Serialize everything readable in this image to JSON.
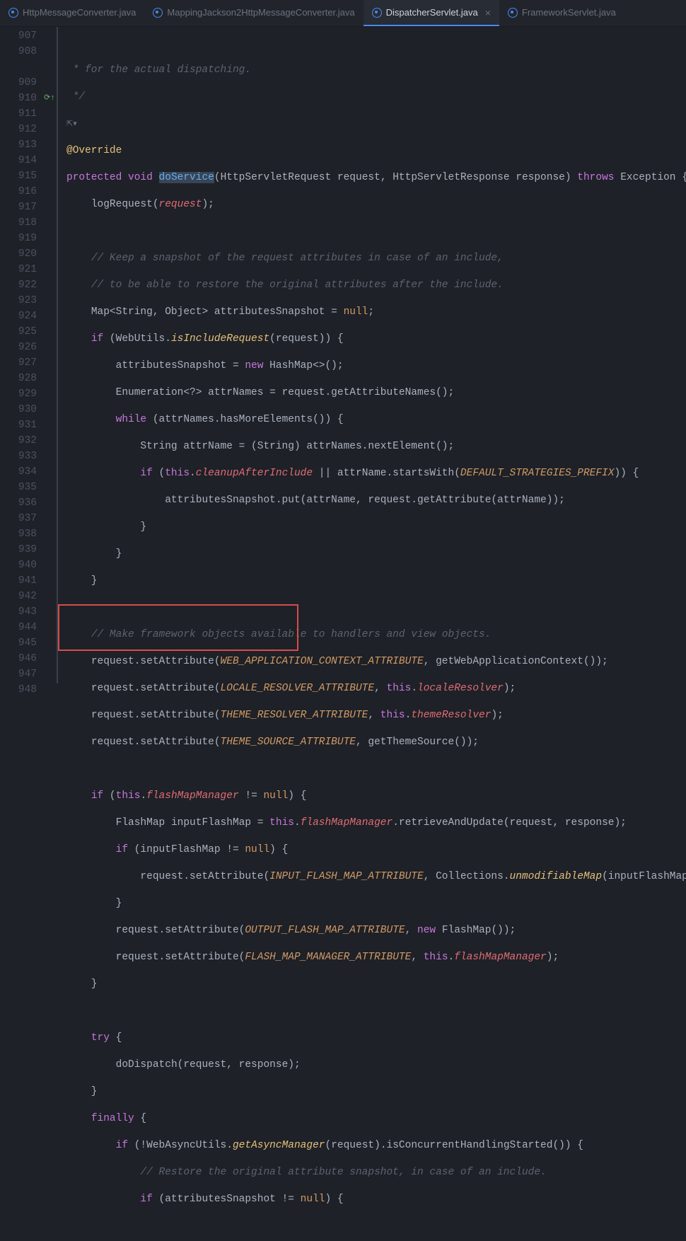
{
  "tabs": [
    {
      "label": "HttpMessageConverter.java",
      "active": false,
      "close": false
    },
    {
      "label": "MappingJackson2HttpMessageConverter.java",
      "active": false,
      "close": false
    },
    {
      "label": "DispatcherServlet.java",
      "active": true,
      "close": true
    },
    {
      "label": "FrameworkServlet.java",
      "active": false,
      "close": false
    }
  ],
  "gutter_start": 907,
  "line_numbers": [
    "907",
    "908",
    "",
    "909",
    "910",
    "911",
    "912",
    "913",
    "914",
    "915",
    "916",
    "917",
    "918",
    "919",
    "920",
    "921",
    "922",
    "923",
    "924",
    "925",
    "926",
    "927",
    "928",
    "929",
    "930",
    "931",
    "932",
    "933",
    "934",
    "935",
    "936",
    "937",
    "938",
    "939",
    "940",
    "941",
    "942",
    "943",
    "944",
    "945",
    "946",
    "947",
    "948"
  ],
  "marker_line_index": 4,
  "code": {
    "l907": " * for the actual dispatching.",
    "l908": " */",
    "author_hint": "⇱▾",
    "l909": "@Override",
    "l910": {
      "kw_protected": "protected",
      "kw_void": "void",
      "method": "doService",
      "sig_open": "(HttpServletRequest request, HttpServletResponse response)",
      "throws": "throws",
      "exc": "Exception {"
    },
    "l911": {
      "call": "logRequest",
      "open": "(",
      "arg": "request",
      "close": ");"
    },
    "l913": "// Keep a snapshot of the request attributes in case of an include,",
    "l914": "// to be able to restore the original attributes after the include.",
    "l915": {
      "a": "Map<String, Object> attributesSnapshot = ",
      "null": "null",
      "semi": ";"
    },
    "l916": {
      "if": "if",
      "open": " (WebUtils.",
      "fn": "isIncludeRequest",
      "after": "(request)) {"
    },
    "l917": {
      "a": "attributesSnapshot = ",
      "new": "new",
      "after": " HashMap<>();"
    },
    "l918": "Enumeration<?> attrNames = request.getAttributeNames();",
    "l919": {
      "while": "while",
      "after": " (attrNames.hasMoreElements()) {"
    },
    "l920": "String attrName = (String) attrNames.nextElement();",
    "l921": {
      "if": "if",
      "open": " (",
      "this": "this",
      "dot": ".",
      "field": "cleanupAfterInclude",
      "mid": " || attrName.startsWith(",
      "const": "DEFAULT_STRATEGIES_PREFIX",
      "close": ")) {"
    },
    "l922": "attributesSnapshot.put(attrName, request.getAttribute(attrName));",
    "l927": "// Make framework objects available to handlers and view objects.",
    "l928": {
      "pre": "request.setAttribute(",
      "const": "WEB_APPLICATION_CONTEXT_ATTRIBUTE",
      "post": ", getWebApplicationContext());"
    },
    "l929": {
      "pre": "request.setAttribute(",
      "const": "LOCALE_RESOLVER_ATTRIBUTE",
      "post": ", ",
      "this": "this",
      "dot": ".",
      "field": "localeResolver",
      "end": ");"
    },
    "l930": {
      "pre": "request.setAttribute(",
      "const": "THEME_RESOLVER_ATTRIBUTE",
      "post": ", ",
      "this": "this",
      "dot": ".",
      "field": "themeResolver",
      "end": ");"
    },
    "l931": {
      "pre": "request.setAttribute(",
      "const": "THEME_SOURCE_ATTRIBUTE",
      "post": ", getThemeSource());"
    },
    "l933": {
      "if": "if",
      "open": " (",
      "this": "this",
      "dot": ".",
      "field": "flashMapManager",
      "mid": " != ",
      "null": "null",
      "close": ") {"
    },
    "l934": {
      "a": "FlashMap inputFlashMap = ",
      "this": "this",
      "dot": ".",
      "field": "flashMapManager",
      "after": ".retrieveAndUpdate(request, response);"
    },
    "l935": {
      "if": "if",
      "open": " (inputFlashMap != ",
      "null": "null",
      "close": ") {"
    },
    "l936": {
      "pre": "request.setAttribute(",
      "const": "INPUT_FLASH_MAP_ATTRIBUTE",
      "mid": ", Collections.",
      "fn": "unmodifiableMap",
      "post": "(inputFlashMap));"
    },
    "l938": {
      "pre": "request.setAttribute(",
      "const": "OUTPUT_FLASH_MAP_ATTRIBUTE",
      "mid": ", ",
      "new": "new",
      "post": " FlashMap());"
    },
    "l939": {
      "pre": "request.setAttribute(",
      "const": "FLASH_MAP_MANAGER_ATTRIBUTE",
      "mid": ", ",
      "this": "this",
      "dot": ".",
      "field": "flashMapManager",
      "end": ");"
    },
    "l942": {
      "try": "try",
      "brace": " {"
    },
    "l943": "doDispatch(request, response);",
    "l945": {
      "finally": "finally",
      "brace": " {"
    },
    "l946": {
      "if": "if",
      "open": " (!WebAsyncUtils.",
      "fn": "getAsyncManager",
      "after": "(request).isConcurrentHandlingStarted()) {"
    },
    "l947": "// Restore the original attribute snapshot, in case of an include.",
    "l948": {
      "if": "if",
      "open": " (attributesSnapshot != ",
      "null": "null",
      "close": ") {"
    }
  },
  "highlight": {
    "top_line": 37,
    "height_lines": 3
  }
}
